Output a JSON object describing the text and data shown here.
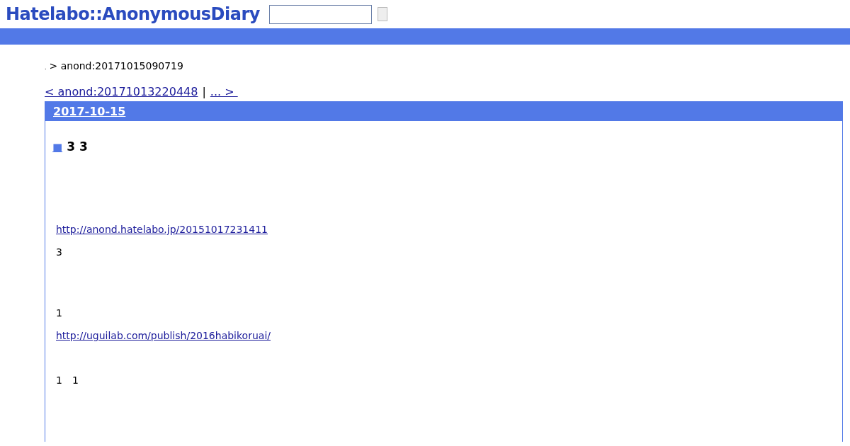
{
  "header": {
    "logo": "Hatelabo::AnonymousDiary"
  },
  "breadcrumb": {
    "root": ".",
    "current": "> anond:20171015090719"
  },
  "pager": {
    "prev": "< anond:20171013220448",
    "separator": "|",
    "next": "... > "
  },
  "day": {
    "date": "2017-10-15",
    "section": {
      "mark": "■",
      "title": "3 3"
    },
    "body": [
      {
        "kind": "link",
        "text": "http://anond.hatelabo.jp/20151017231411"
      },
      {
        "kind": "text",
        "text": "3"
      },
      {
        "kind": "text",
        "text": "1"
      },
      {
        "kind": "link",
        "text": "http://uguilab.com/publish/2016habikoruai/"
      },
      {
        "kind": "text",
        "text": "1　1"
      }
    ]
  }
}
